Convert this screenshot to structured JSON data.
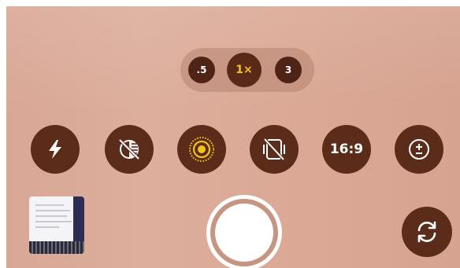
{
  "zoom": {
    "options": [
      ".5",
      "1×",
      "3"
    ],
    "active": "1×"
  },
  "controls": {
    "flash_icon": "flash-icon",
    "filter_icon": "filter-off-icon",
    "live_photo_icon": "live-photo-icon",
    "live_photo_color": "#f2c21a",
    "stabilize_icon": "stabilization-off-icon",
    "aspect_ratio": "16:9",
    "exposure_icon": "exposure-icon"
  },
  "bottom": {
    "gallery_thumbnail": "last-photo-thumbnail",
    "shutter": "shutter-button",
    "switch_camera_icon": "switch-camera-icon"
  },
  "colors": {
    "control_bg": "#5c2c1a",
    "active_zoom_text": "#f2c21a",
    "viewfinder": "#dcae9c"
  }
}
